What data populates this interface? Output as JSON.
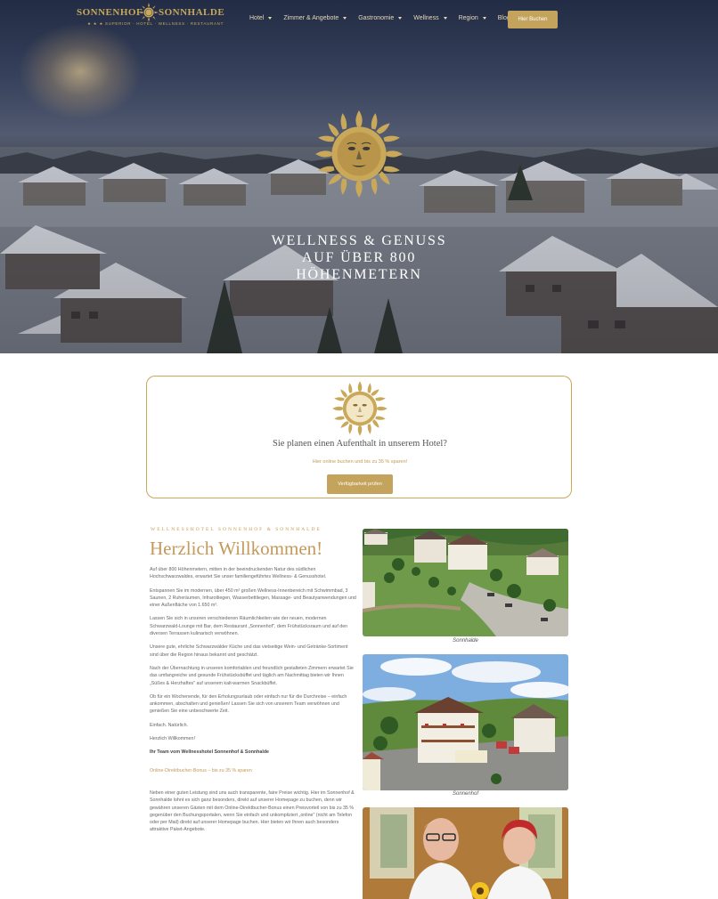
{
  "header": {
    "logo_left": "SONNENHOF",
    "logo_right": "SONNHALDE",
    "logo_sub": "★ ★ ★  SUPERIOR · HOTEL · WELLNESS · RESTAURANT",
    "nav": [
      {
        "label": "Hotel",
        "has_dropdown": true
      },
      {
        "label": "Zimmer & Angebote",
        "has_dropdown": true
      },
      {
        "label": "Gastronomie",
        "has_dropdown": true
      },
      {
        "label": "Wellness",
        "has_dropdown": true
      },
      {
        "label": "Region",
        "has_dropdown": true
      },
      {
        "label": "Blog",
        "has_dropdown": false
      }
    ],
    "book_label": "Hier Buchen"
  },
  "hero": {
    "title_lines": [
      "WELLNESS & GENUSS",
      "AUF ÜBER 800",
      "HÖHENMETERN"
    ]
  },
  "booking": {
    "title": "Sie planen einen Aufenthalt in unserem Hotel?",
    "subtitle": "Hier online buchen und bis zu 35 % sparen!",
    "button": "Verfügbarkeit prüfen"
  },
  "intro": {
    "eyebrow": "WELLNESSHOTEL SONNENHOF & SONNHALDE",
    "heading": "Herzlich Willkommen!",
    "paragraphs": [
      "Auf über 800 Höhenmetern, mitten in der beeindruckenden Natur des südlichen Hochschwarzwaldes, erwartet Sie unser familiengeführtes Wellness- & Genusshotel.",
      "Entspannen Sie im modernen, über 450 m² großen Wellness-Innenbereich mit Schwimmbad, 3 Saunen, 2 Ruheräumen, Infrarotliegen, Wasserbettliegen, Massage- und Beautyanwendungen und einer Außenfläche von 1.650 m².",
      "Lassen Sie sich in unseren verschiedenen Räumlichkeiten wie der neuen, modernen Schwarzwald-Lounge mit Bar, dem Restaurant „Sonnenhof\", dem Frühstücksraum und auf den diversen Terrassen kulinarisch verwöhnen.",
      "Unsere gute, ehrliche Schwarzwälder Küche und das vielseitige Wein- und Getränke-Sortiment sind über die Region hinaus bekannt und geschätzt.",
      "Nach der Übernachtung in unseren komfortablen und freundlich gestalteten Zimmern erwartet Sie das umfangreiche und gesunde Frühstücksbüffet und täglich am Nachmittag bieten wir Ihnen „Süßes & Herzhaftes\" auf unserem kalt-warmen Snackbüffet.",
      "Ob für ein Wochenende, für den Erholungsurlaub oder einfach nur für die Durchreise – einfach ankommen, abschalten und genießen! Lassen Sie sich von unserem Team verwöhnen und genießen Sie eine unbeschwerte Zeit.",
      "Einfach. Natürlich.",
      "Herzlich Willkommen!"
    ],
    "signature": "Ihr Team vom Wellnesshotel Sonnenhof & Sonnhalde",
    "bonus_heading": "Online-Direktbucher-Bonus – bis zu 35 % sparen",
    "bonus_text": "Neben einer guten Leistung sind uns auch transparente, faire Preise wichtig. Hier im Sonnenhof & Sonnhalde lohnt es sich ganz besonders, direkt auf unserer Homepage zu buchen, denn wir gewähren unseren Gästen mit dem Online-Direktbucher-Bonus einen Preisvorteil von bis zu 35 % gegenüber den Buchungsportalen, wenn Sie einfach und unkompliziert „online\" (nicht am Telefon oder per Mail) direkt auf unserer Homepage buchen. Hier bieten wir Ihnen auch besonders attraktive Paket-Angebote."
  },
  "photos": [
    {
      "caption": "Sonnhalde"
    },
    {
      "caption": "Sonnenhof"
    }
  ],
  "colors": {
    "gold": "#c4a45c",
    "gold_text": "#c49a55",
    "hero_sky": "#3f4a66"
  }
}
